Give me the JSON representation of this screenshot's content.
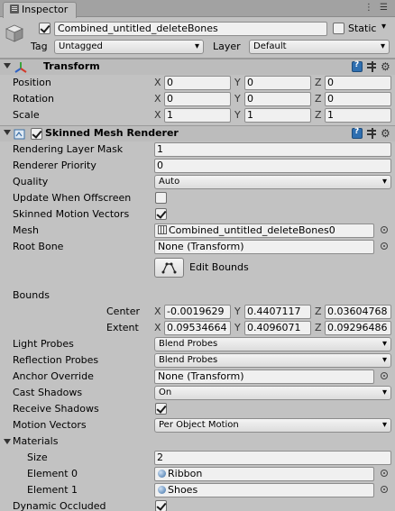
{
  "tab": {
    "title": "Inspector",
    "controls": "⋮ ☰"
  },
  "object": {
    "active": true,
    "name": "Combined_untitled_deleteBones",
    "static_label": "Static",
    "static_checked": false,
    "tag_label": "Tag",
    "tag_value": "Untagged",
    "layer_label": "Layer",
    "layer_value": "Default"
  },
  "transform": {
    "title": "Transform",
    "position": {
      "label": "Position",
      "x": "0",
      "y": "0",
      "z": "0"
    },
    "rotation": {
      "label": "Rotation",
      "x": "0",
      "y": "0",
      "z": "0"
    },
    "scale": {
      "label": "Scale",
      "x": "1",
      "y": "1",
      "z": "1"
    },
    "axis_x": "X",
    "axis_y": "Y",
    "axis_z": "Z"
  },
  "renderer": {
    "title": "Skinned Mesh Renderer",
    "enabled": true,
    "rendering_layer_mask": {
      "label": "Rendering Layer Mask",
      "value": "1"
    },
    "renderer_priority": {
      "label": "Renderer Priority",
      "value": "0"
    },
    "quality": {
      "label": "Quality",
      "value": "Auto"
    },
    "update_when_offscreen": {
      "label": "Update When Offscreen",
      "checked": false
    },
    "skinned_motion_vectors": {
      "label": "Skinned Motion Vectors",
      "checked": true
    },
    "mesh": {
      "label": "Mesh",
      "value": "Combined_untitled_deleteBones0"
    },
    "root_bone": {
      "label": "Root Bone",
      "value": "None (Transform)"
    },
    "edit_bounds": {
      "label": "Edit Bounds"
    },
    "bounds": {
      "label": "Bounds",
      "center": {
        "label": "Center",
        "x": "-0.0019629",
        "y": "0.4407117",
        "z": "0.03604768"
      },
      "extent": {
        "label": "Extent",
        "x": "0.09534664",
        "y": "0.4096071",
        "z": "0.09296486"
      }
    },
    "light_probes": {
      "label": "Light Probes",
      "value": "Blend Probes"
    },
    "reflection_probes": {
      "label": "Reflection Probes",
      "value": "Blend Probes"
    },
    "anchor_override": {
      "label": "Anchor Override",
      "value": "None (Transform)"
    },
    "cast_shadows": {
      "label": "Cast Shadows",
      "value": "On"
    },
    "receive_shadows": {
      "label": "Receive Shadows",
      "checked": true
    },
    "motion_vectors": {
      "label": "Motion Vectors",
      "value": "Per Object Motion"
    },
    "materials": {
      "label": "Materials",
      "size": {
        "label": "Size",
        "value": "2"
      },
      "element0": {
        "label": "Element 0",
        "value": "Ribbon"
      },
      "element1": {
        "label": "Element 1",
        "value": "Shoes"
      }
    },
    "dynamic_occluded": {
      "label": "Dynamic Occluded",
      "checked": true
    }
  }
}
